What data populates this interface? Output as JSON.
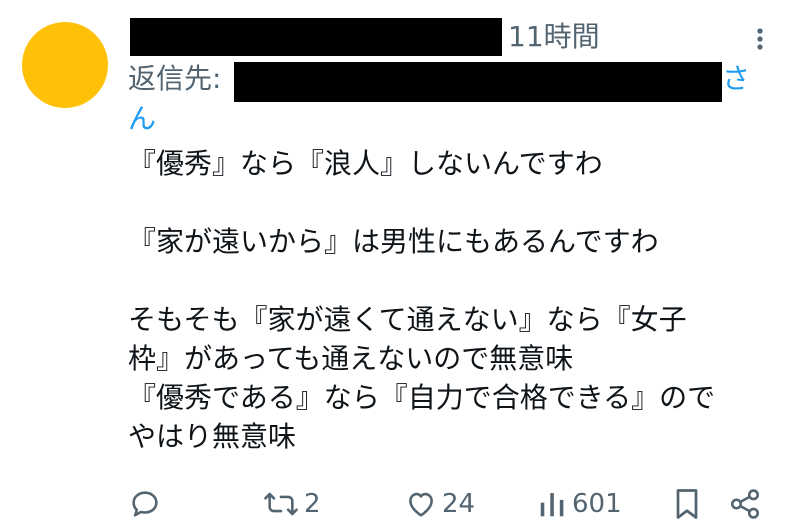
{
  "header": {
    "time": "11時間",
    "reply_to_label": "返信先:",
    "handle_suffix": [
      "さ",
      "ん"
    ]
  },
  "tweet": {
    "lines": [
      "『優秀』なら『浪人』しないんですわ",
      "",
      "『家が遠いから』は男性にもあるんですわ",
      "",
      "そもそも『家が遠くて通えない』なら『女子",
      "枠』があっても通えないので無意味",
      "『優秀である』なら『自力で合格できる』ので",
      "やはり無意味"
    ]
  },
  "actions": {
    "reply_icon": "reply-icon",
    "retweet_icon": "retweet-icon",
    "retweet_count": "2",
    "like_icon": "heart-icon",
    "like_count": "24",
    "views_icon": "bar-chart-icon",
    "views_count": "601",
    "bookmark_icon": "bookmark-icon",
    "share_icon": "share-icon"
  },
  "colors": {
    "avatar": "#ffc107",
    "link": "#1d9bf0",
    "muted": "#536471",
    "text": "#0f1419"
  }
}
